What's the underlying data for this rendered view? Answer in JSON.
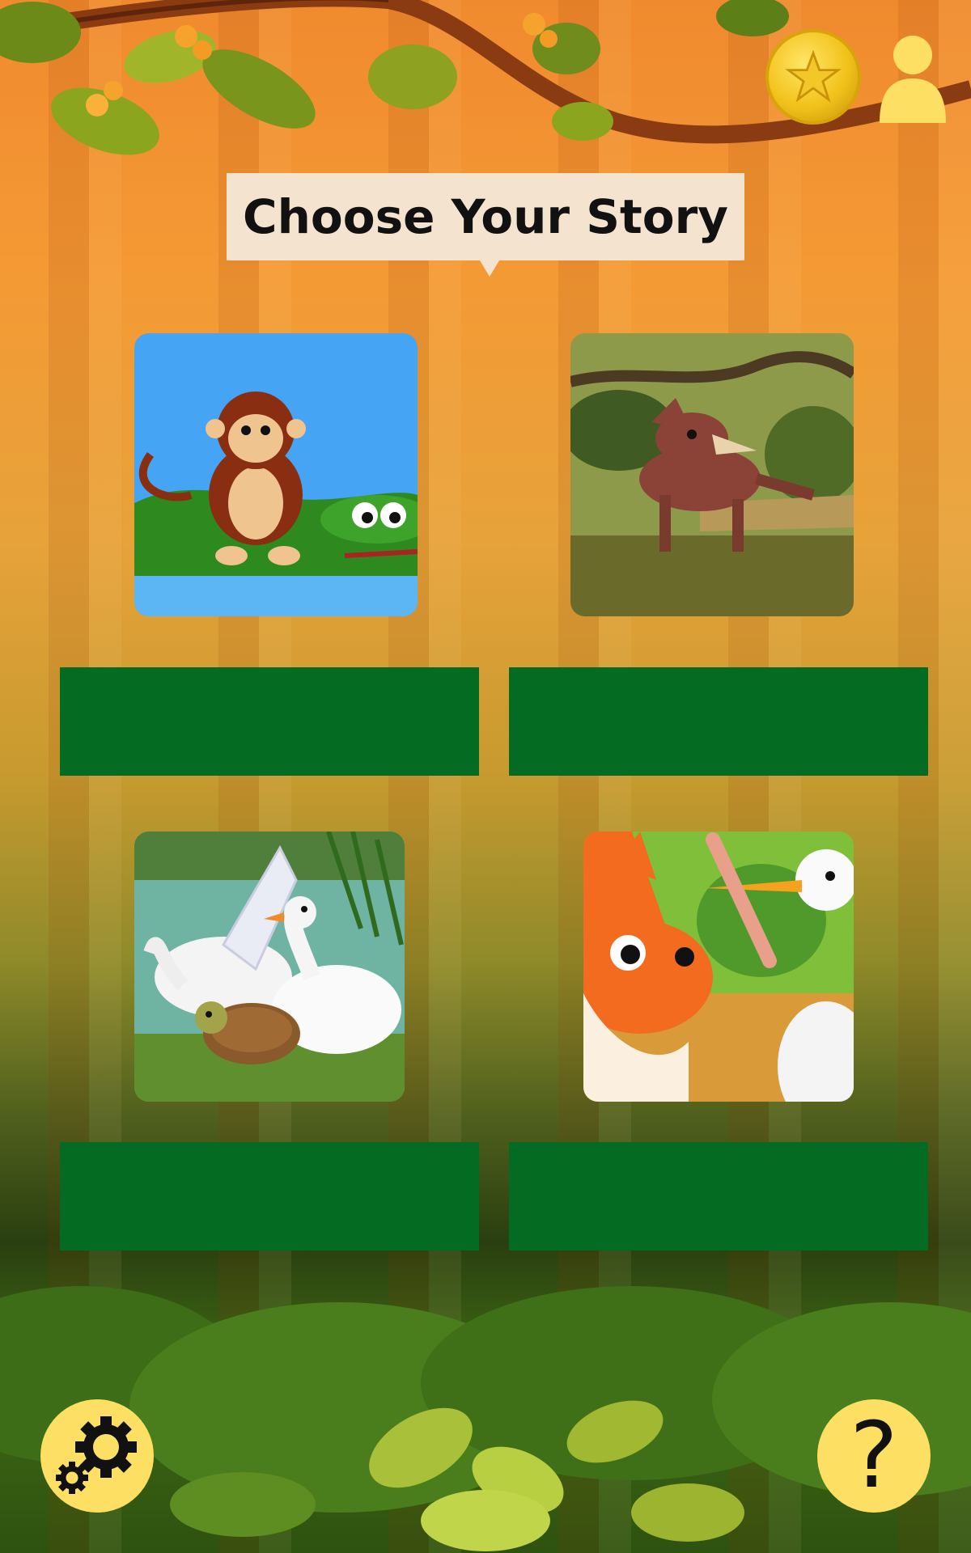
{
  "header": {
    "title": "Choose Your Story",
    "coin_icon": "star-coin-icon",
    "profile_icon": "user-icon"
  },
  "stories": [
    {
      "illustration": "monkey-and-crocodile",
      "label": ""
    },
    {
      "illustration": "fox-in-forest",
      "label": ""
    },
    {
      "illustration": "swans-and-tortoise",
      "label": ""
    },
    {
      "illustration": "fox-and-stork",
      "label": ""
    }
  ],
  "footer": {
    "settings_icon": "gear-icon",
    "help_label": "?"
  },
  "colors": {
    "label_bar": "#036b22",
    "button_yellow": "#fde063",
    "title_bg": "#f3e3cf"
  }
}
